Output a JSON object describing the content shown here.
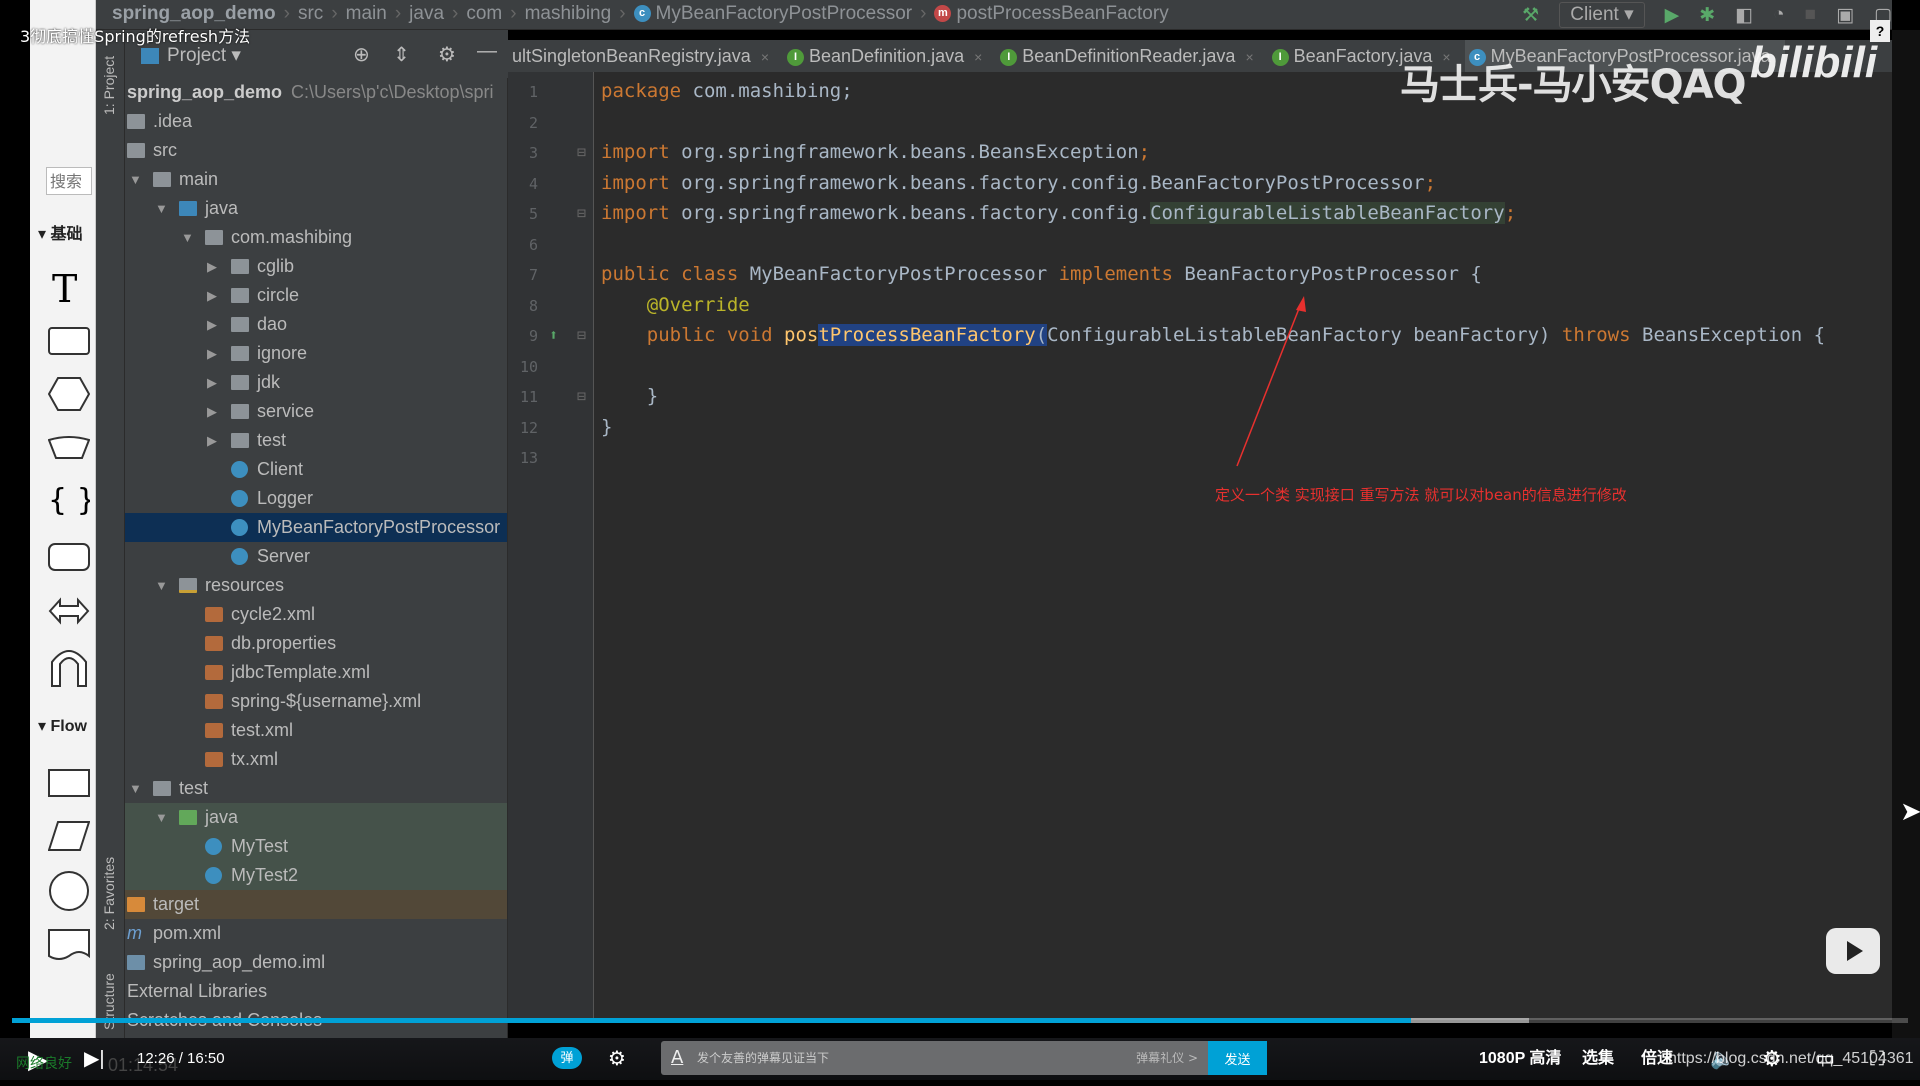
{
  "video": {
    "title": "3彻底搞懂Spring的refresh方法",
    "current_time": "12:26 / 16:50",
    "elapsed_dim": "01:14:54",
    "network": "网络良好",
    "progress_fraction": 0.738,
    "buffered_fraction": 0.8,
    "danmaku_toggle": "弹",
    "danmaku_placeholder": "发个友善的弹幕见证当下",
    "danmaku_etiquette": "弹幕礼仪 >",
    "send_label": "发送",
    "quality": "1080P 高清",
    "episodes": "选集",
    "speed": "倍速",
    "accent": "#00a1d6",
    "watermark": "马士兵-马小安QAQ",
    "platform_logo": "bilibili",
    "csdn_url": "https://blog.csdn.net/qq_45104361"
  },
  "palette": {
    "search_placeholder": "搜索",
    "section_basic": "基础",
    "section_flow": "Flow"
  },
  "ide": {
    "breadcrumb": [
      "spring_aop_demo",
      "src",
      "main",
      "java",
      "com",
      "mashibing",
      "MyBeanFactoryPostProcessor",
      "postProcessBeanFactory"
    ],
    "run_config": "Client",
    "side_labels": {
      "project": "1: Project",
      "favorites": "2: Favorites",
      "structure": "Structure"
    },
    "project_panel": {
      "title": "Project",
      "root_name": "spring_aop_demo",
      "root_path": "C:\\Users\\p'c\\Desktop\\spri",
      "items": [
        {
          "label": ".idea",
          "level": -1,
          "arrow": "none",
          "icon": "folder"
        },
        {
          "label": "src",
          "level": -1,
          "arrow": "none",
          "icon": "folder"
        },
        {
          "label": "main",
          "level": 0,
          "arrow": "open",
          "icon": "folder"
        },
        {
          "label": "java",
          "level": 1,
          "arrow": "open",
          "icon": "folder-blue"
        },
        {
          "label": "com.mashibing",
          "level": 2,
          "arrow": "open",
          "icon": "package"
        },
        {
          "label": "cglib",
          "level": 3,
          "arrow": "closed",
          "icon": "package"
        },
        {
          "label": "circle",
          "level": 3,
          "arrow": "closed",
          "icon": "package"
        },
        {
          "label": "dao",
          "level": 3,
          "arrow": "closed",
          "icon": "package"
        },
        {
          "label": "ignore",
          "level": 3,
          "arrow": "closed",
          "icon": "package"
        },
        {
          "label": "jdk",
          "level": 3,
          "arrow": "closed",
          "icon": "package"
        },
        {
          "label": "service",
          "level": 3,
          "arrow": "closed",
          "icon": "package"
        },
        {
          "label": "test",
          "level": 3,
          "arrow": "closed",
          "icon": "package"
        },
        {
          "label": "Client",
          "level": 3,
          "arrow": "leaf",
          "icon": "class"
        },
        {
          "label": "Logger",
          "level": 3,
          "arrow": "leaf",
          "icon": "class"
        },
        {
          "label": "MyBeanFactoryPostProcessor",
          "level": 3,
          "arrow": "leaf",
          "icon": "class",
          "state": "selected"
        },
        {
          "label": "Server",
          "level": 3,
          "arrow": "leaf",
          "icon": "class"
        },
        {
          "label": "resources",
          "level": 1,
          "arrow": "open",
          "icon": "folder-res"
        },
        {
          "label": "cycle2.xml",
          "level": 2,
          "arrow": "leaf",
          "icon": "xml"
        },
        {
          "label": "db.properties",
          "level": 2,
          "arrow": "leaf",
          "icon": "xml"
        },
        {
          "label": "jdbcTemplate.xml",
          "level": 2,
          "arrow": "leaf",
          "icon": "xml"
        },
        {
          "label": "spring-${username}.xml",
          "level": 2,
          "arrow": "leaf",
          "icon": "xml"
        },
        {
          "label": "test.xml",
          "level": 2,
          "arrow": "leaf",
          "icon": "xml"
        },
        {
          "label": "tx.xml",
          "level": 2,
          "arrow": "leaf",
          "icon": "xml"
        },
        {
          "label": "test",
          "level": 0,
          "arrow": "open",
          "icon": "folder"
        },
        {
          "label": "java",
          "level": 1,
          "arrow": "open",
          "icon": "folder-green",
          "state": "test"
        },
        {
          "label": "MyTest",
          "level": 2,
          "arrow": "leaf",
          "icon": "class",
          "state": "test"
        },
        {
          "label": "MyTest2",
          "level": 2,
          "arrow": "leaf",
          "icon": "class",
          "state": "test"
        },
        {
          "label": "target",
          "level": -1,
          "arrow": "none",
          "icon": "folder-orange",
          "state": "excluded"
        },
        {
          "label": "pom.xml",
          "level": -1,
          "arrow": "none",
          "icon": "maven"
        },
        {
          "label": "spring_aop_demo.iml",
          "level": -1,
          "arrow": "none",
          "icon": "module"
        },
        {
          "label": "External Libraries",
          "level": -2,
          "arrow": "none",
          "icon": "none"
        },
        {
          "label": "Scratches and Consoles",
          "level": -2,
          "arrow": "none",
          "icon": "none"
        }
      ]
    },
    "tabs": [
      {
        "label": "ultSingletonBeanRegistry.java",
        "icon": "class"
      },
      {
        "label": "BeanDefinition.java",
        "icon": "interface"
      },
      {
        "label": "BeanDefinitionReader.java",
        "icon": "interface"
      },
      {
        "label": "BeanFactory.java",
        "icon": "interface"
      },
      {
        "label": "MyBeanFactoryPostProcessor.java",
        "icon": "class",
        "active": true
      }
    ],
    "code_lines": [
      [
        [
          "kw",
          "package "
        ],
        [
          "",
          "com.mashibing;"
        ]
      ],
      [],
      [
        [
          "kw",
          "import "
        ],
        [
          "",
          "org.springframework.beans.BeansException"
        ],
        [
          "kw",
          ";"
        ]
      ],
      [
        [
          "kw",
          "import "
        ],
        [
          "",
          "org.springframework.beans.factory.config.BeanFactoryPostProcessor"
        ],
        [
          "kw",
          ";"
        ]
      ],
      [
        [
          "kw",
          "import "
        ],
        [
          "",
          "org.springframework.beans.factory.config."
        ],
        [
          "hl2",
          "ConfigurableListableBeanFactory"
        ],
        [
          "kw",
          ";"
        ]
      ],
      [],
      [
        [
          "kw",
          "public class "
        ],
        [
          "",
          "MyBeanFactoryPostProcessor "
        ],
        [
          "kw",
          "implements "
        ],
        [
          "",
          "BeanFactoryPostProcessor {"
        ]
      ],
      [
        [
          "an",
          "    @Override"
        ]
      ],
      [
        [
          "kw",
          "    public void "
        ],
        [
          "fn",
          "pos"
        ],
        [
          "fnhl",
          "tProcessBeanFactory"
        ],
        [
          "hl",
          "("
        ],
        [
          "",
          "ConfigurableListableBeanFactory beanFactory) "
        ],
        [
          "kw",
          "throws "
        ],
        [
          "",
          "BeansException {"
        ]
      ],
      [],
      [
        [
          "",
          "    }"
        ]
      ],
      [
        [
          "",
          "}"
        ]
      ],
      []
    ],
    "annotation": {
      "text": "定义一个类  实现接口  重写方法  就可以对bean的信息进行修改",
      "color": "#e8302e"
    }
  }
}
